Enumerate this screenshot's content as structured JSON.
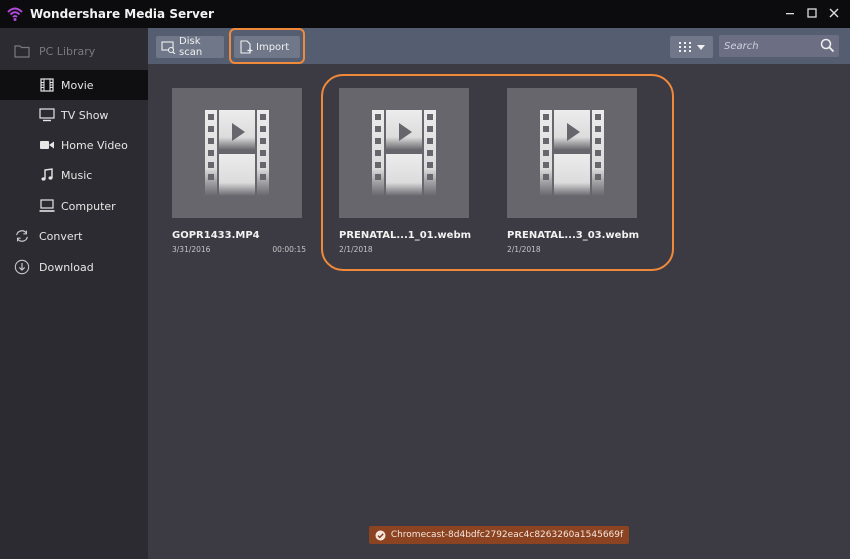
{
  "window": {
    "title": "Wondershare Media Server"
  },
  "sidebar": {
    "items": [
      {
        "label": "PC Library",
        "icon": "folder-icon"
      },
      {
        "label": "Movie",
        "icon": "film-icon"
      },
      {
        "label": "TV Show",
        "icon": "monitor-icon"
      },
      {
        "label": "Home Video",
        "icon": "video-camera-icon"
      },
      {
        "label": "Music",
        "icon": "music-note-icon"
      },
      {
        "label": "Computer",
        "icon": "computer-icon"
      },
      {
        "label": "Convert",
        "icon": "convert-icon"
      },
      {
        "label": "Download",
        "icon": "download-icon"
      }
    ],
    "active": "Movie"
  },
  "toolbar": {
    "disk_scan_label": "Disk scan",
    "import_label": "Import",
    "search_placeholder": "Search"
  },
  "media": [
    {
      "title": "GOPR1433.MP4",
      "date": "3/31/2016",
      "duration": "00:00:15"
    },
    {
      "title": "PRENATAL...1_01.webm",
      "date": "2/1/2018",
      "duration": ""
    },
    {
      "title": "PRENATAL...3_03.webm",
      "date": "2/1/2018",
      "duration": ""
    }
  ],
  "status": {
    "text": "Chromecast-8d4bdfc2792eac4c8263260a1545669f"
  },
  "colors": {
    "highlight": "#f08a3a",
    "status_bar": "#8c4322",
    "toolbar": "#555e70",
    "sidebar": "#2c2b31",
    "content": "#3c3b43"
  }
}
